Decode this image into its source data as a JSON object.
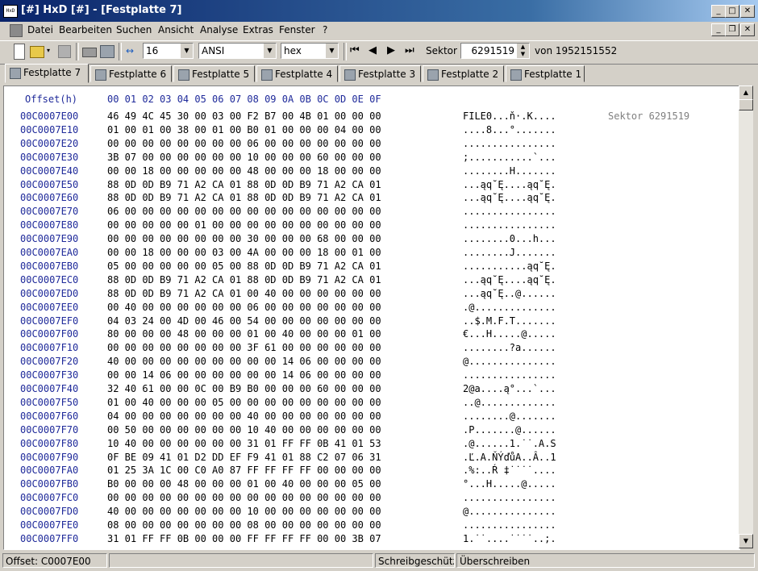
{
  "window": {
    "title": "[#] HxD [#] - [Festplatte 7]",
    "app_icon_glyph": "HxD"
  },
  "menu": [
    "Datei",
    "Bearbeiten",
    "Suchen",
    "Ansicht",
    "Analyse",
    "Extras",
    "Fenster",
    "?"
  ],
  "toolbar": {
    "bytes_per_row": "16",
    "charset": "ANSI",
    "display": "hex",
    "sector_label": "Sektor",
    "sector_value": "6291519",
    "sector_total": "von 1952151552"
  },
  "tabs": [
    "Festplatte 7",
    "Festplatte 6",
    "Festplatte 5",
    "Festplatte 4",
    "Festplatte 3",
    "Festplatte 2",
    "Festplatte 1"
  ],
  "editor": {
    "header_offset": "Offset(h)",
    "header_columns": "00 01 02 03 04 05 06 07 08 09 0A 0B 0C 0D 0E 0F",
    "sector_note": "Sektor 6291519",
    "rows": [
      {
        "offset": "00C0007E00",
        "hex": "46 49 4C 45 30 00 03 00 F2 B7 00 4B 01 00 00 00",
        "ascii": "FILE0...ň·.K...."
      },
      {
        "offset": "00C0007E10",
        "hex": "01 00 01 00 38 00 01 00 B0 01 00 00 00 04 00 00",
        "ascii": "....8...°......."
      },
      {
        "offset": "00C0007E20",
        "hex": "00 00 00 00 00 00 00 00 06 00 00 00 00 00 00 00",
        "ascii": "................"
      },
      {
        "offset": "00C0007E30",
        "hex": "3B 07 00 00 00 00 00 00 10 00 00 00 60 00 00 00",
        "ascii": ";...........`..."
      },
      {
        "offset": "00C0007E40",
        "hex": "00 00 18 00 00 00 00 00 48 00 00 00 18 00 00 00",
        "ascii": "........H......."
      },
      {
        "offset": "00C0007E50",
        "hex": "88 0D 0D B9 71 A2 CA 01 88 0D 0D B9 71 A2 CA 01",
        "ascii": "...ąq˘Ę....ąq˘Ę."
      },
      {
        "offset": "00C0007E60",
        "hex": "88 0D 0D B9 71 A2 CA 01 88 0D 0D B9 71 A2 CA 01",
        "ascii": "...ąq˘Ę....ąq˘Ę."
      },
      {
        "offset": "00C0007E70",
        "hex": "06 00 00 00 00 00 00 00 00 00 00 00 00 00 00 00",
        "ascii": "................"
      },
      {
        "offset": "00C0007E80",
        "hex": "00 00 00 00 00 01 00 00 00 00 00 00 00 00 00 00",
        "ascii": "................"
      },
      {
        "offset": "00C0007E90",
        "hex": "00 00 00 00 00 00 00 00 30 00 00 00 68 00 00 00",
        "ascii": "........0...h..."
      },
      {
        "offset": "00C0007EA0",
        "hex": "00 00 18 00 00 00 03 00 4A 00 00 00 18 00 01 00",
        "ascii": "........J......."
      },
      {
        "offset": "00C0007EB0",
        "hex": "05 00 00 00 00 00 05 00 88 0D 0D B9 71 A2 CA 01",
        "ascii": "...........ąq˘Ę."
      },
      {
        "offset": "00C0007EC0",
        "hex": "88 0D 0D B9 71 A2 CA 01 88 0D 0D B9 71 A2 CA 01",
        "ascii": "...ąq˘Ę....ąq˘Ę."
      },
      {
        "offset": "00C0007ED0",
        "hex": "88 0D 0D B9 71 A2 CA 01 00 40 00 00 00 00 00 00",
        "ascii": "...ąq˘Ę..@......"
      },
      {
        "offset": "00C0007EE0",
        "hex": "00 40 00 00 00 00 00 00 06 00 00 00 00 00 00 00",
        "ascii": ".@.............."
      },
      {
        "offset": "00C0007EF0",
        "hex": "04 03 24 00 4D 00 46 00 54 00 00 00 00 00 00 00",
        "ascii": "..$.M.F.T......."
      },
      {
        "offset": "00C0007F00",
        "hex": "80 00 00 00 48 00 00 00 01 00 40 00 00 00 01 00",
        "ascii": "€...H.....@....."
      },
      {
        "offset": "00C0007F10",
        "hex": "00 00 00 00 00 00 00 00 3F 61 00 00 00 00 00 00",
        "ascii": "........?a......"
      },
      {
        "offset": "00C0007F20",
        "hex": "40 00 00 00 00 00 00 00 00 00 14 06 00 00 00 00",
        "ascii": "@..............."
      },
      {
        "offset": "00C0007F30",
        "hex": "00 00 14 06 00 00 00 00 00 00 14 06 00 00 00 00",
        "ascii": "................"
      },
      {
        "offset": "00C0007F40",
        "hex": "32 40 61 00 00 0C 00 B9 B0 00 00 00 60 00 00 00",
        "ascii": "2@a....ą°...`..."
      },
      {
        "offset": "00C0007F50",
        "hex": "01 00 40 00 00 00 05 00 00 00 00 00 00 00 00 00",
        "ascii": "..@............."
      },
      {
        "offset": "00C0007F60",
        "hex": "04 00 00 00 00 00 00 00 40 00 00 00 00 00 00 00",
        "ascii": "........@......."
      },
      {
        "offset": "00C0007F70",
        "hex": "00 50 00 00 00 00 00 00 10 40 00 00 00 00 00 00",
        "ascii": ".P.......@......"
      },
      {
        "offset": "00C0007F80",
        "hex": "10 40 00 00 00 00 00 00 31 01 FF FF 0B 41 01 53",
        "ascii": ".@......1.˙˙.A.S"
      },
      {
        "offset": "00C0007F90",
        "hex": "0F BE 09 41 01 D2 DD EF F9 41 01 88 C2 07 06 31",
        "ascii": ".Ľ.A.ŇÝďůA..Â..1"
      },
      {
        "offset": "00C0007FA0",
        "hex": "01 25 3A 1C 00 C0 A0 87 FF FF FF FF 00 00 00 00",
        "ascii": ".%:..Ŕ ‡˙˙˙˙...."
      },
      {
        "offset": "00C0007FB0",
        "hex": "B0 00 00 00 48 00 00 00 01 00 40 00 00 00 05 00",
        "ascii": "°...H.....@....."
      },
      {
        "offset": "00C0007FC0",
        "hex": "00 00 00 00 00 00 00 00 00 00 00 00 00 00 00 00",
        "ascii": "................"
      },
      {
        "offset": "00C0007FD0",
        "hex": "40 00 00 00 00 00 00 00 10 00 00 00 00 00 00 00",
        "ascii": "@..............."
      },
      {
        "offset": "00C0007FE0",
        "hex": "08 00 00 00 00 00 00 00 08 00 00 00 00 00 00 00",
        "ascii": "................"
      },
      {
        "offset": "00C0007FF0",
        "hex": "31 01 FF FF 0B 00 00 00 FF FF FF FF 00 00 3B 07",
        "ascii": "1.˙˙....˙˙˙˙..;."
      }
    ]
  },
  "status": {
    "offset": "Offset: C0007E00",
    "readonly": "Schreibgeschützt",
    "mode": "Überschreiben"
  }
}
